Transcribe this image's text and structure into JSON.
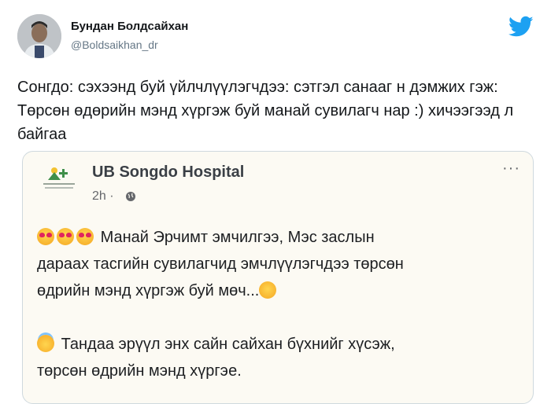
{
  "author": {
    "name": "Бундан Болдсайхан",
    "handle": "@Boldsaikhan_dr"
  },
  "tweet": {
    "text": "Сонгдо: сэхээнд буй үйлчлүүлэгчдээ: сэтгэл санааг н дэмжих гэж: Төрсөн өдөрийн мэнд хүргэж буй манай сувилагч нар :) хичээгээд л байгаа"
  },
  "card": {
    "page_name": "UB Songdo Hospital",
    "time": "2h ·",
    "more": "···",
    "line1": "Манай Эрчимт эмчилгээ, Мэс заслын",
    "line2": "дараах тасгийн сувилагчид эмчлүүлэгчдээ төрсөн",
    "line3": "өдрийн мэнд хүргэж буй мөч...",
    "line4": "Тандаа эрүүл энх сайн сайхан бүхнийг хүсэж,",
    "line5": "төрсөн өдрийн мэнд хүргэе."
  },
  "colors": {
    "twitter_blue": "#1da1f2",
    "card_bg": "#fcfaf3"
  },
  "icons": [
    "twitter-bird-icon",
    "globe-icon",
    "heart-eyes-emoji",
    "party-face-emoji",
    "angel-emoji"
  ]
}
